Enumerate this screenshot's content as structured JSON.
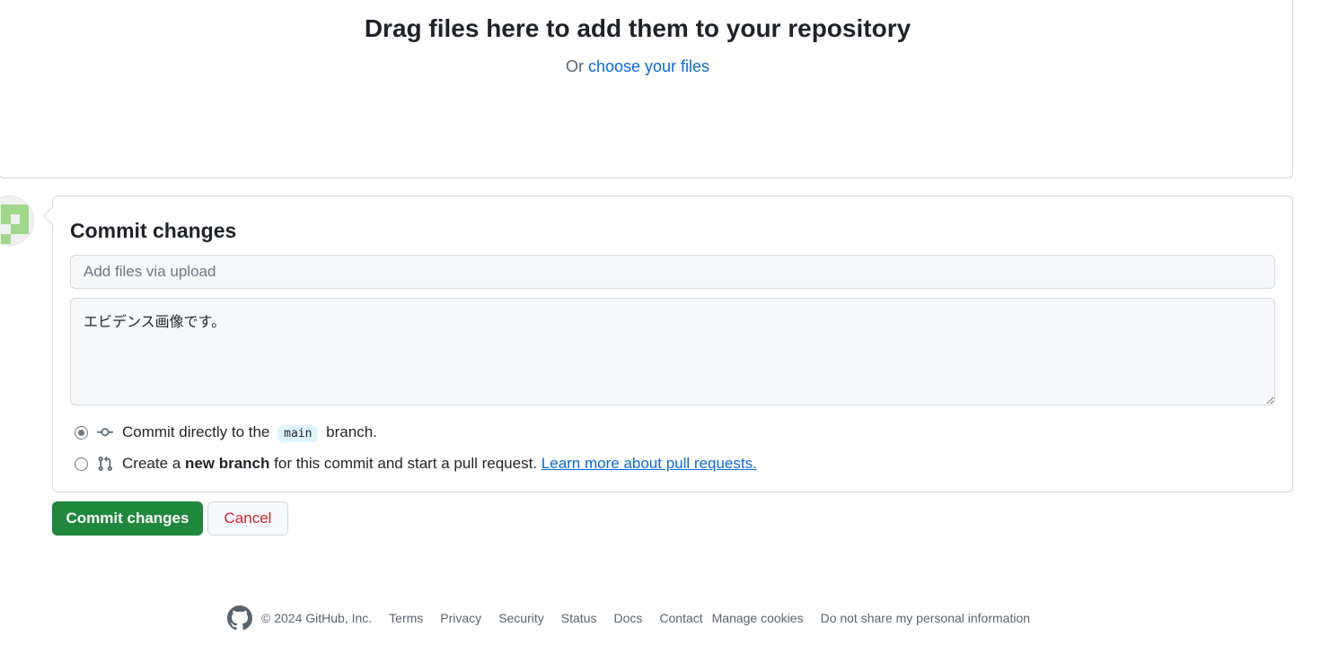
{
  "dropzone": {
    "title": "Drag files here to add them to your repository",
    "or_text": "Or",
    "choose_link": "choose your files"
  },
  "commit": {
    "heading": "Commit changes",
    "summary_placeholder": "Add files via upload",
    "summary_value": "",
    "description_value": "エビデンス画像です。",
    "option_direct": {
      "prefix": "Commit directly to the",
      "branch": "main",
      "suffix": "branch.",
      "checked": true
    },
    "option_new_branch": {
      "prefix": "Create a",
      "bold": "new branch",
      "suffix": "for this commit and start a pull request.",
      "link": "Learn more about pull requests.",
      "checked": false
    },
    "submit_label": "Commit changes",
    "cancel_label": "Cancel"
  },
  "footer": {
    "copyright": "© 2024 GitHub, Inc.",
    "links": [
      "Terms",
      "Privacy",
      "Security",
      "Status",
      "Docs",
      "Contact",
      "Manage cookies",
      "Do not share my personal information"
    ]
  },
  "icons": {
    "avatar": "identicon-avatar",
    "commit": "git-commit-icon",
    "pull_request": "git-pull-request-icon",
    "logo": "github-mark-icon"
  },
  "colors": {
    "primary_button": "#1f883d",
    "link": "#0969da",
    "danger": "#cf222e",
    "border": "#d0d7de"
  }
}
